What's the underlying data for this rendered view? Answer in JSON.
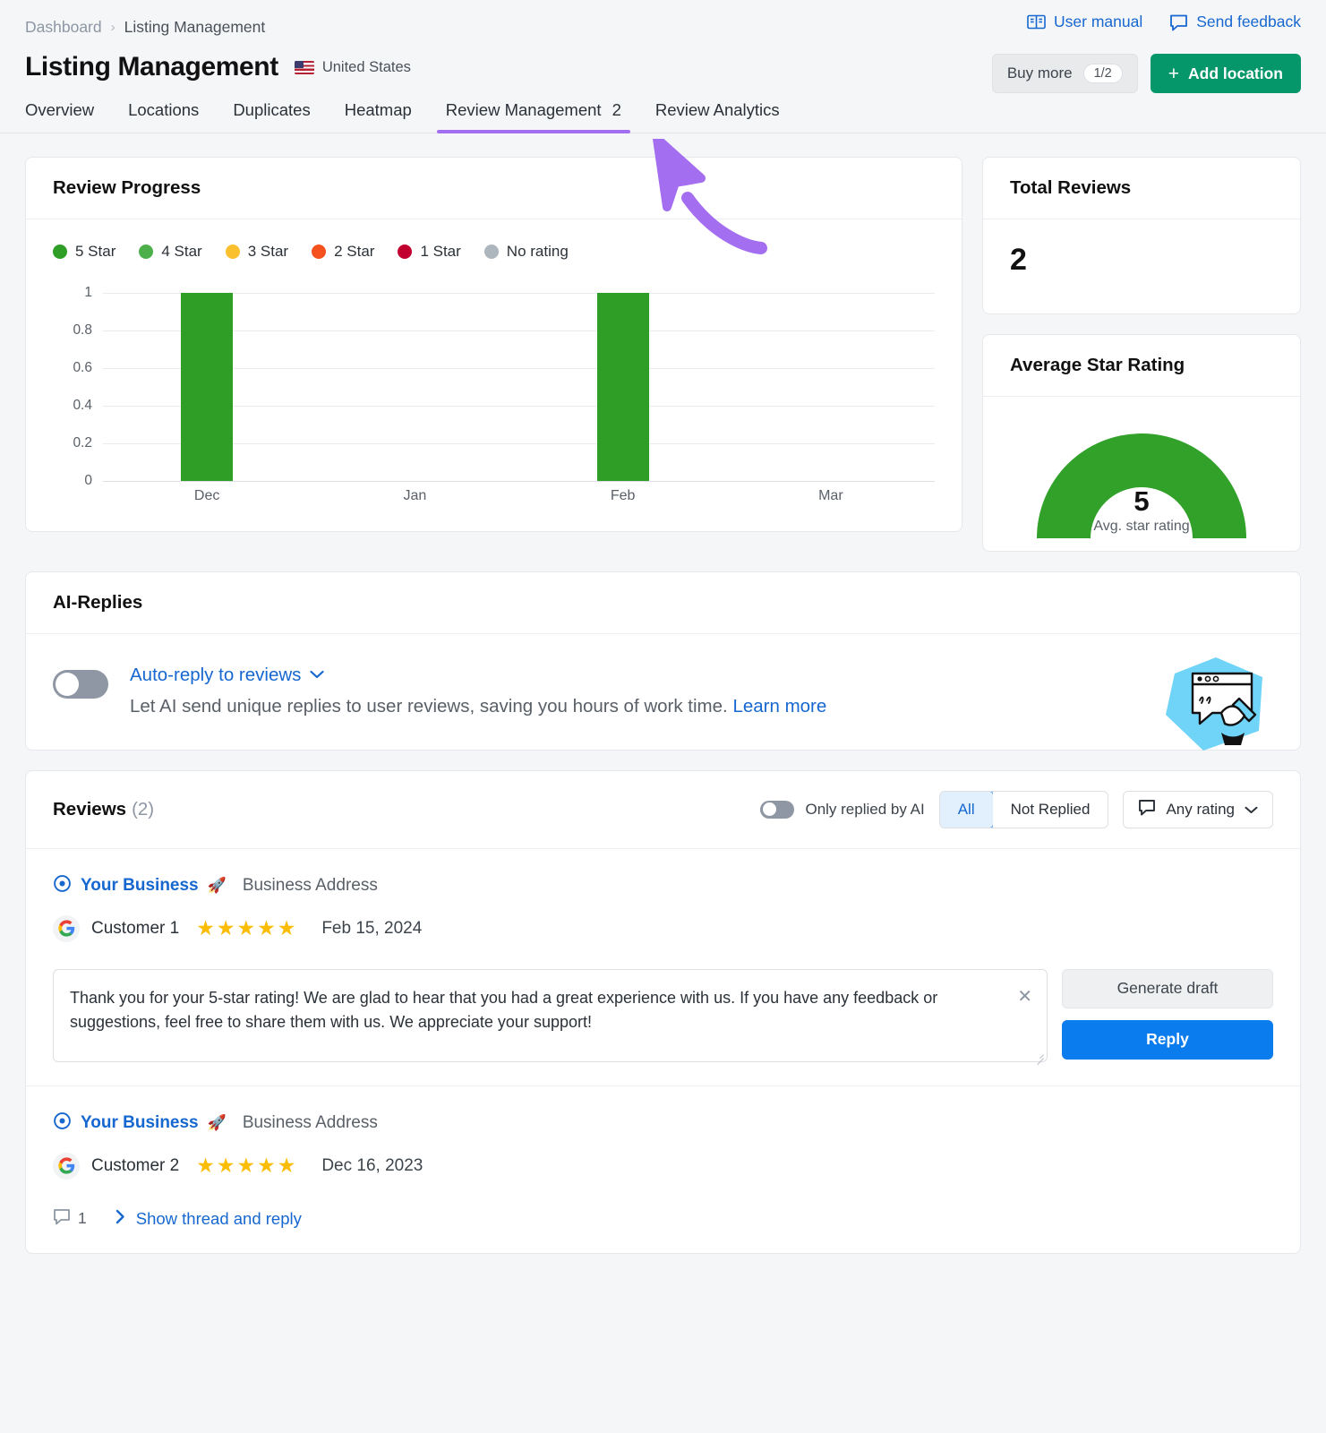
{
  "breadcrumb": {
    "root": "Dashboard",
    "separator": "›",
    "current": "Listing Management"
  },
  "header": {
    "title": "Listing Management",
    "country": "United States",
    "user_manual": "User manual",
    "send_feedback": "Send feedback",
    "buy_more": "Buy more",
    "buy_more_count": "1/2",
    "add_location": "Add location",
    "add_plus": "+"
  },
  "tabs": [
    {
      "label": "Overview",
      "active": false,
      "count": ""
    },
    {
      "label": "Locations",
      "active": false,
      "count": ""
    },
    {
      "label": "Duplicates",
      "active": false,
      "count": ""
    },
    {
      "label": "Heatmap",
      "active": false,
      "count": ""
    },
    {
      "label": "Review Management",
      "active": true,
      "count": "2"
    },
    {
      "label": "Review Analytics",
      "active": false,
      "count": ""
    }
  ],
  "review_progress": {
    "title": "Review Progress"
  },
  "chart_data": {
    "type": "bar",
    "title": "Review Progress",
    "categories": [
      "Dec",
      "Jan",
      "Feb",
      "Mar"
    ],
    "series": [
      {
        "name": "5 Star",
        "color": "#2e9e26",
        "values": [
          1,
          0,
          1,
          0
        ]
      },
      {
        "name": "4 Star",
        "color": "#4caf4a",
        "values": [
          0,
          0,
          0,
          0
        ]
      },
      {
        "name": "3 Star",
        "color": "#fbc02d",
        "values": [
          0,
          0,
          0,
          0
        ]
      },
      {
        "name": "2 Star",
        "color": "#f4511e",
        "values": [
          0,
          0,
          0,
          0
        ]
      },
      {
        "name": "1 Star",
        "color": "#c2002f",
        "values": [
          0,
          0,
          0,
          0
        ]
      },
      {
        "name": "No rating",
        "color": "#adb5bd",
        "values": [
          0,
          0,
          0,
          0
        ]
      }
    ],
    "yticks": [
      "1",
      "0.8",
      "0.6",
      "0.4",
      "0.2",
      "0"
    ],
    "ylim": [
      0,
      1
    ],
    "xlabel": "",
    "ylabel": "",
    "grid": true,
    "legend_position": "top-left"
  },
  "total_reviews": {
    "title": "Total Reviews",
    "value": "2"
  },
  "avg_star_rating": {
    "title": "Average Star Rating",
    "value": "5",
    "caption": "Avg. star rating",
    "max": 5,
    "color": "#32a12a"
  },
  "ai_replies": {
    "title": "AI-Replies",
    "toggle_on": false,
    "link_label": "Auto-reply to reviews",
    "description": "Let AI send unique replies to user reviews, saving you hours of work time.",
    "learn_more": "Learn more"
  },
  "reviews_panel": {
    "title": "Reviews",
    "count": "(2)",
    "only_replied_by_ai": "Only replied by AI",
    "only_replied_toggle_on": false,
    "segments": [
      {
        "label": "All",
        "active": true
      },
      {
        "label": "Not Replied",
        "active": false
      }
    ],
    "rating_filter": "Any rating"
  },
  "reviews": [
    {
      "business": "Your Business",
      "rocket": "🚀",
      "address": "Business Address",
      "customer": "Customer 1",
      "stars": 5,
      "date": "Feb 15, 2024",
      "reply_draft": "Thank you for your 5-star rating! We are glad to hear that you had a great experience with us. If you have any feedback or suggestions, feel free to share them with us. We appreciate your support!",
      "generate_draft": "Generate draft",
      "reply_button": "Reply"
    },
    {
      "business": "Your Business",
      "rocket": "🚀",
      "address": "Business Address",
      "customer": "Customer 2",
      "stars": 5,
      "date": "Dec 16, 2023",
      "thread_count": "1",
      "thread_link": "Show thread and reply"
    }
  ],
  "annotation": {
    "arrow_color": "#a46ef0"
  }
}
